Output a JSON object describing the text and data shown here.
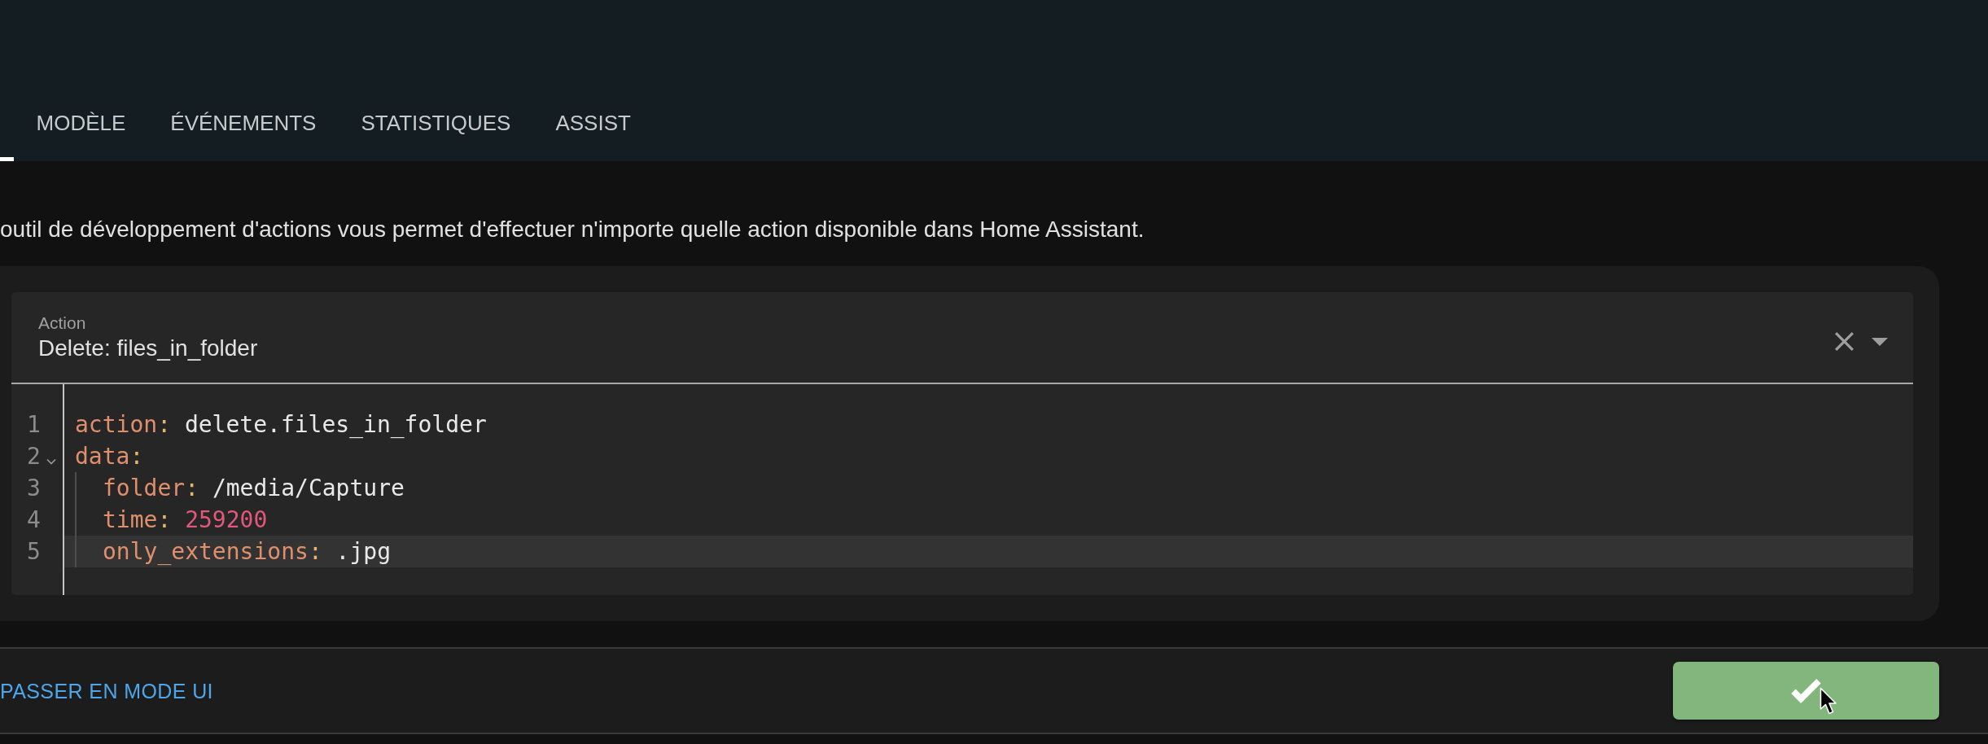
{
  "header": {
    "tabs": [
      {
        "selected": true
      },
      {
        "label": "MODÈLE",
        "selected": false
      },
      {
        "label": "ÉVÉNEMENTS",
        "selected": false
      },
      {
        "label": "STATISTIQUES",
        "selected": false
      },
      {
        "label": "ASSIST",
        "selected": false
      }
    ]
  },
  "description": "outil de développement d'actions vous permet d'effectuer n'importe quelle action disponible dans Home Assistant.",
  "card": {
    "action_field": {
      "label": "Action",
      "value": "Delete: files_in_folder"
    },
    "editor": {
      "lines": [
        {
          "number": "1",
          "active": false,
          "tokens": [
            {
              "kind": "key",
              "text": "action"
            },
            {
              "kind": "colon",
              "text": ":"
            },
            {
              "kind": "string",
              "text": "delete.files_in_folder"
            }
          ]
        },
        {
          "number": "2",
          "active": false,
          "expanded": true,
          "tokens": [
            {
              "kind": "key",
              "text": "data"
            },
            {
              "kind": "colon",
              "text": ":"
            }
          ],
          "children": [
            {
              "number": "3",
              "active": false,
              "tokens": [
                {
                  "kind": "key",
                  "text": "folder"
                },
                {
                  "kind": "colon",
                  "text": ":"
                },
                {
                  "kind": "string",
                  "text": "/media/Capture"
                }
              ]
            },
            {
              "number": "4",
              "active": false,
              "tokens": [
                {
                  "kind": "key",
                  "text": "time"
                },
                {
                  "kind": "colon",
                  "text": ":"
                },
                {
                  "kind": "number",
                  "text": "259200"
                }
              ]
            },
            {
              "number": "5",
              "active": true,
              "tokens": [
                {
                  "kind": "key",
                  "text": "only_extensions"
                },
                {
                  "kind": "colon",
                  "text": ":"
                },
                {
                  "kind": "string",
                  "text": ".jpg"
                }
              ]
            }
          ]
        }
      ]
    }
  },
  "footer": {
    "mode_link": "PASSER EN MODE UI"
  }
}
